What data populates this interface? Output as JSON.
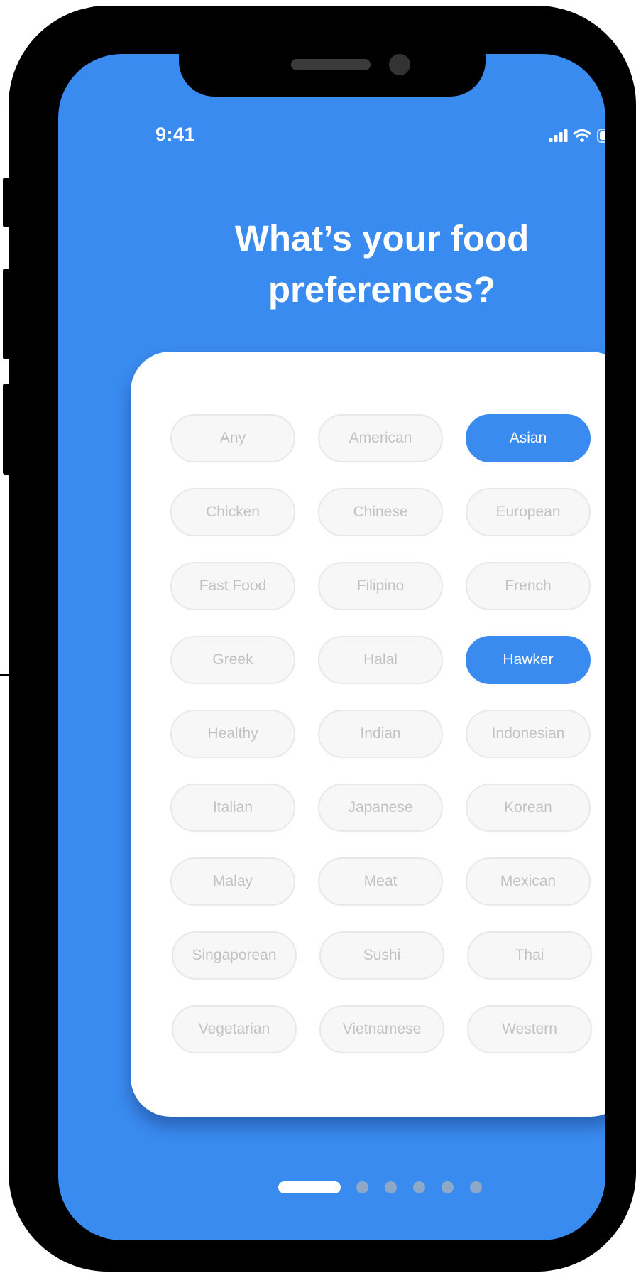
{
  "status_bar": {
    "time": "9:41",
    "signal_icon": "cellular-signal-icon",
    "wifi_icon": "wifi-icon",
    "battery_icon": "battery-icon"
  },
  "page": {
    "title_line1": "What’s your food",
    "title_line2": "preferences?"
  },
  "preferences": [
    {
      "label": "Any",
      "selected": false
    },
    {
      "label": "American",
      "selected": false
    },
    {
      "label": "Asian",
      "selected": true
    },
    {
      "label": "Chicken",
      "selected": false
    },
    {
      "label": "Chinese",
      "selected": false
    },
    {
      "label": "European",
      "selected": false
    },
    {
      "label": "Fast Food",
      "selected": false
    },
    {
      "label": "Filipino",
      "selected": false
    },
    {
      "label": "French",
      "selected": false
    },
    {
      "label": "Greek",
      "selected": false
    },
    {
      "label": "Halal",
      "selected": false
    },
    {
      "label": "Hawker",
      "selected": true
    },
    {
      "label": "Healthy",
      "selected": false
    },
    {
      "label": "Indian",
      "selected": false
    },
    {
      "label": "Indonesian",
      "selected": false
    },
    {
      "label": "Italian",
      "selected": false
    },
    {
      "label": "Japanese",
      "selected": false
    },
    {
      "label": "Korean",
      "selected": false
    },
    {
      "label": "Malay",
      "selected": false
    },
    {
      "label": "Meat",
      "selected": false
    },
    {
      "label": "Mexican",
      "selected": false
    },
    {
      "label": "Singaporean",
      "selected": false
    },
    {
      "label": "Sushi",
      "selected": false
    },
    {
      "label": "Thai",
      "selected": false
    },
    {
      "label": "Vegetarian",
      "selected": false
    },
    {
      "label": "Vietnamese",
      "selected": false
    },
    {
      "label": "Western",
      "selected": false
    }
  ],
  "pagination": {
    "total_pages": 6,
    "current_page": 1
  },
  "colors": {
    "accent": "#3a8bf0",
    "chip_background": "#f7f7f7",
    "chip_text": "#c2c2c2",
    "selected_text": "#ffffff"
  }
}
